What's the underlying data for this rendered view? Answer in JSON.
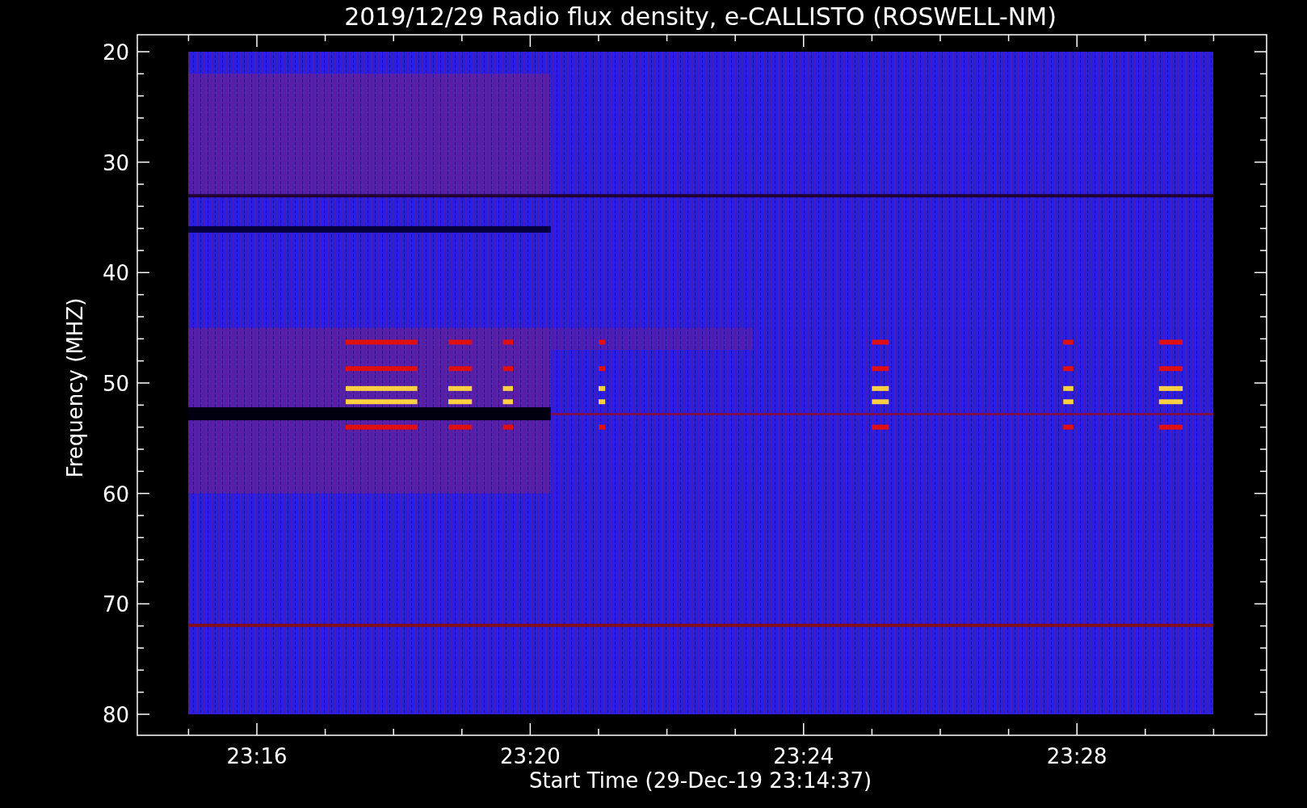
{
  "title": "2019/12/29  Radio flux density, e-CALLISTO (ROSWELL-NM)",
  "y_axis": {
    "label": "Frequency (MHZ)",
    "ticks": [
      "20",
      "30",
      "40",
      "50",
      "60",
      "70",
      "80"
    ]
  },
  "x_axis": {
    "label": "Start Time (29-Dec-19 23:14:37)",
    "ticks": [
      "23:16",
      "23:20",
      "23:24",
      "23:28"
    ]
  }
}
